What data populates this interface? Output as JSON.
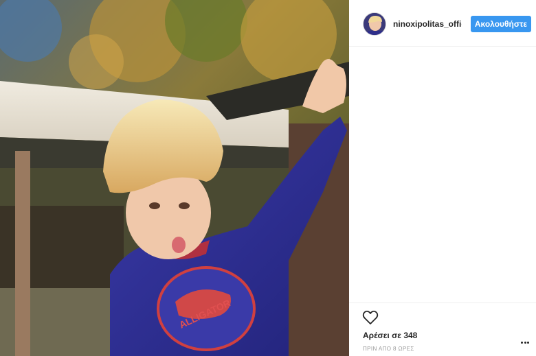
{
  "header": {
    "username": "ninoxipolitas_offic",
    "follow_label": "Ακολουθήστε"
  },
  "photo": {
    "subject": "child-photo",
    "shirt_text": "ALLIGATOR"
  },
  "actions": {
    "like_icon": "heart-icon",
    "likes_text": "Αρέσει σε 348",
    "timestamp": "ΠΡΙΝ ΑΠΟ 8 ΩΡΕΣ",
    "more_icon": "more-options-icon"
  },
  "colors": {
    "follow_button": "#3897f0",
    "text_primary": "#262626",
    "text_secondary": "#999999",
    "divider": "#efefef"
  }
}
